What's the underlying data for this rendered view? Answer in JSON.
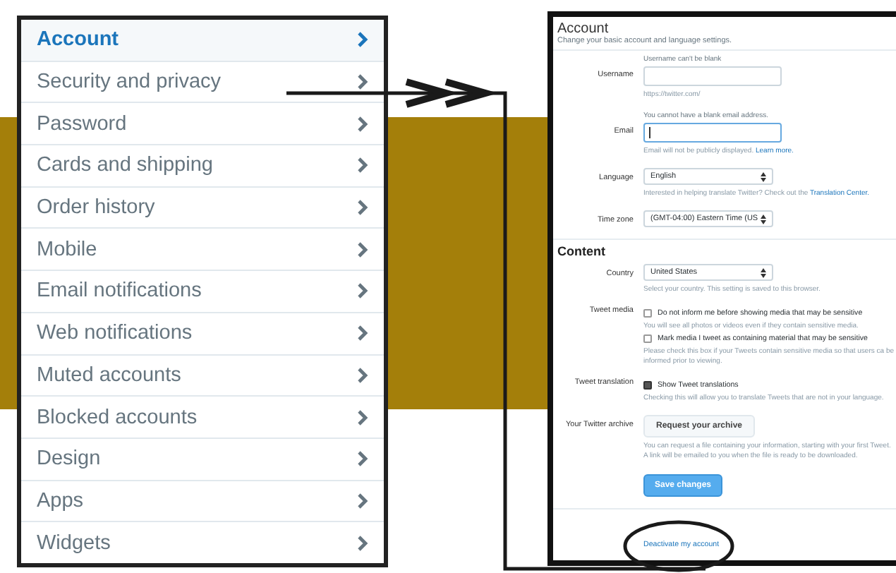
{
  "menu": {
    "items": [
      {
        "label": "Account",
        "selected": true
      },
      {
        "label": "Security and privacy",
        "selected": false
      },
      {
        "label": "Password",
        "selected": false
      },
      {
        "label": "Cards and shipping",
        "selected": false
      },
      {
        "label": "Order history",
        "selected": false
      },
      {
        "label": "Mobile",
        "selected": false
      },
      {
        "label": "Email notifications",
        "selected": false
      },
      {
        "label": "Web notifications",
        "selected": false
      },
      {
        "label": "Muted accounts",
        "selected": false
      },
      {
        "label": "Blocked accounts",
        "selected": false
      },
      {
        "label": "Design",
        "selected": false
      },
      {
        "label": "Apps",
        "selected": false
      },
      {
        "label": "Widgets",
        "selected": false
      }
    ]
  },
  "account": {
    "title": "Account",
    "subtitle": "Change your basic account and language settings.",
    "rows": [
      {
        "kind": "input",
        "label": "Username",
        "hint": "Username can't be blank",
        "focused": false,
        "note": "https://twitter.com/"
      },
      {
        "kind": "input",
        "label": "Email",
        "hint": "You cannot have a blank email address.",
        "focused": true,
        "note": "Email will not be publicly displayed.",
        "link": "Learn more."
      },
      {
        "kind": "select",
        "label": "Language",
        "value": "English",
        "note": "Interested in helping translate Twitter? Check out the",
        "link": "Translation Center."
      },
      {
        "kind": "select",
        "label": "Time zone",
        "value": "(GMT-04:00) Eastern Time (US"
      }
    ]
  },
  "content": {
    "title": "Content",
    "rows": [
      {
        "kind": "select",
        "label": "Country",
        "value": "United States",
        "note": "Select your country. This setting is saved to this browser."
      },
      {
        "kind": "checks",
        "label": "Tweet media",
        "options": [
          {
            "text": "Do not inform me before showing media that may be sensitive",
            "checked": false,
            "note": "You will see all photos or videos even if they contain sensitive media."
          },
          {
            "text": "Mark media I tweet as containing material that may be sensitive",
            "checked": false,
            "note": "Please check this box if your Tweets contain sensitive media so that users ca be informed prior to viewing."
          }
        ]
      },
      {
        "kind": "checks",
        "label": "Tweet translation",
        "options": [
          {
            "text": "Show Tweet translations",
            "checked": true,
            "note": "Checking this will allow you to translate Tweets that are not in your language."
          }
        ]
      },
      {
        "kind": "button",
        "label": "Your Twitter archive",
        "button": "Request your archive",
        "note": "You can request a file containing your information, starting with your first Tweet. A link will be emailed to you when the file is ready to be downloaded."
      }
    ],
    "save_button": "Save changes"
  },
  "deactivate_link": "Deactivate my account"
}
